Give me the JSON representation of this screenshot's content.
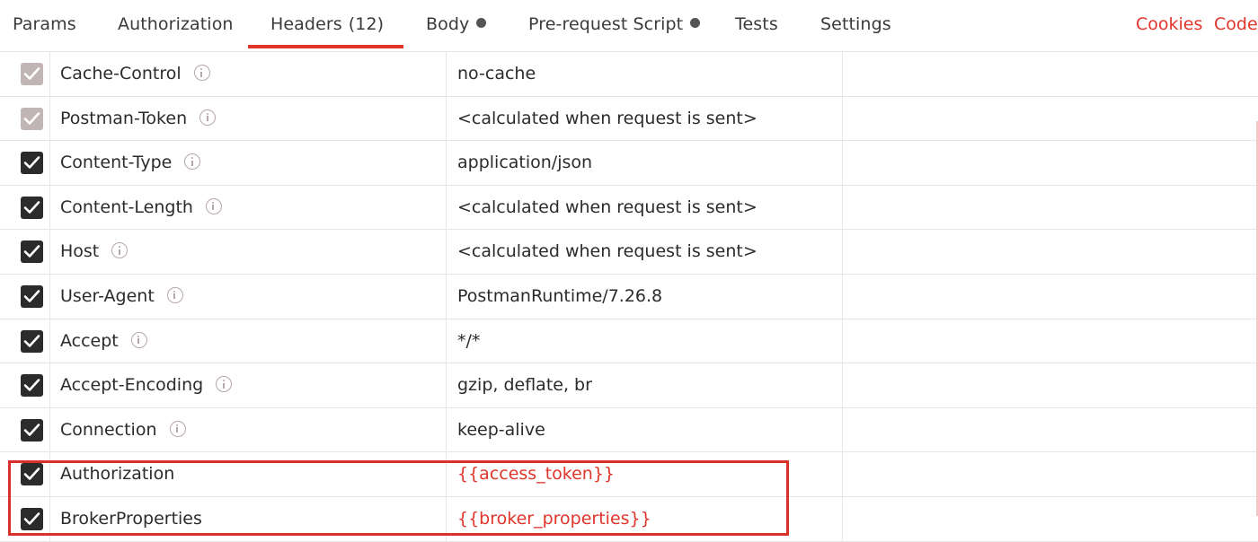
{
  "tabs": [
    {
      "label": "Params"
    },
    {
      "label": "Authorization"
    },
    {
      "label": "Headers",
      "count": "(12)",
      "active": true
    },
    {
      "label": "Body",
      "dot": true
    },
    {
      "label": "Pre-request Script",
      "dot": true
    },
    {
      "label": "Tests"
    },
    {
      "label": "Settings"
    }
  ],
  "links": {
    "cookies": "Cookies",
    "code": "Code"
  },
  "colors": {
    "accent": "#e0352b",
    "text": "#2b2b2b",
    "checkbox_checked": "#2b2b2b",
    "checkbox_disabled": "#b7a9a9"
  },
  "headers": [
    {
      "key": "Cache-Control",
      "value": "no-cache",
      "disabled": true,
      "info": true
    },
    {
      "key": "Postman-Token",
      "value": "<calculated when request is sent>",
      "disabled": true,
      "info": true
    },
    {
      "key": "Content-Type",
      "value": "application/json",
      "info": true
    },
    {
      "key": "Content-Length",
      "value": "<calculated when request is sent>",
      "info": true
    },
    {
      "key": "Host",
      "value": "<calculated when request is sent>",
      "info": true
    },
    {
      "key": "User-Agent",
      "value": "PostmanRuntime/7.26.8",
      "info": true
    },
    {
      "key": "Accept",
      "value": "*/*",
      "info": true
    },
    {
      "key": "Accept-Encoding",
      "value": "gzip, deflate, br",
      "info": true
    },
    {
      "key": "Connection",
      "value": "keep-alive",
      "info": true
    },
    {
      "key": "Authorization",
      "value": "{{access_token}}",
      "variable": true
    },
    {
      "key": "BrokerProperties",
      "value": "{{broker_properties}}",
      "variable": true
    }
  ]
}
